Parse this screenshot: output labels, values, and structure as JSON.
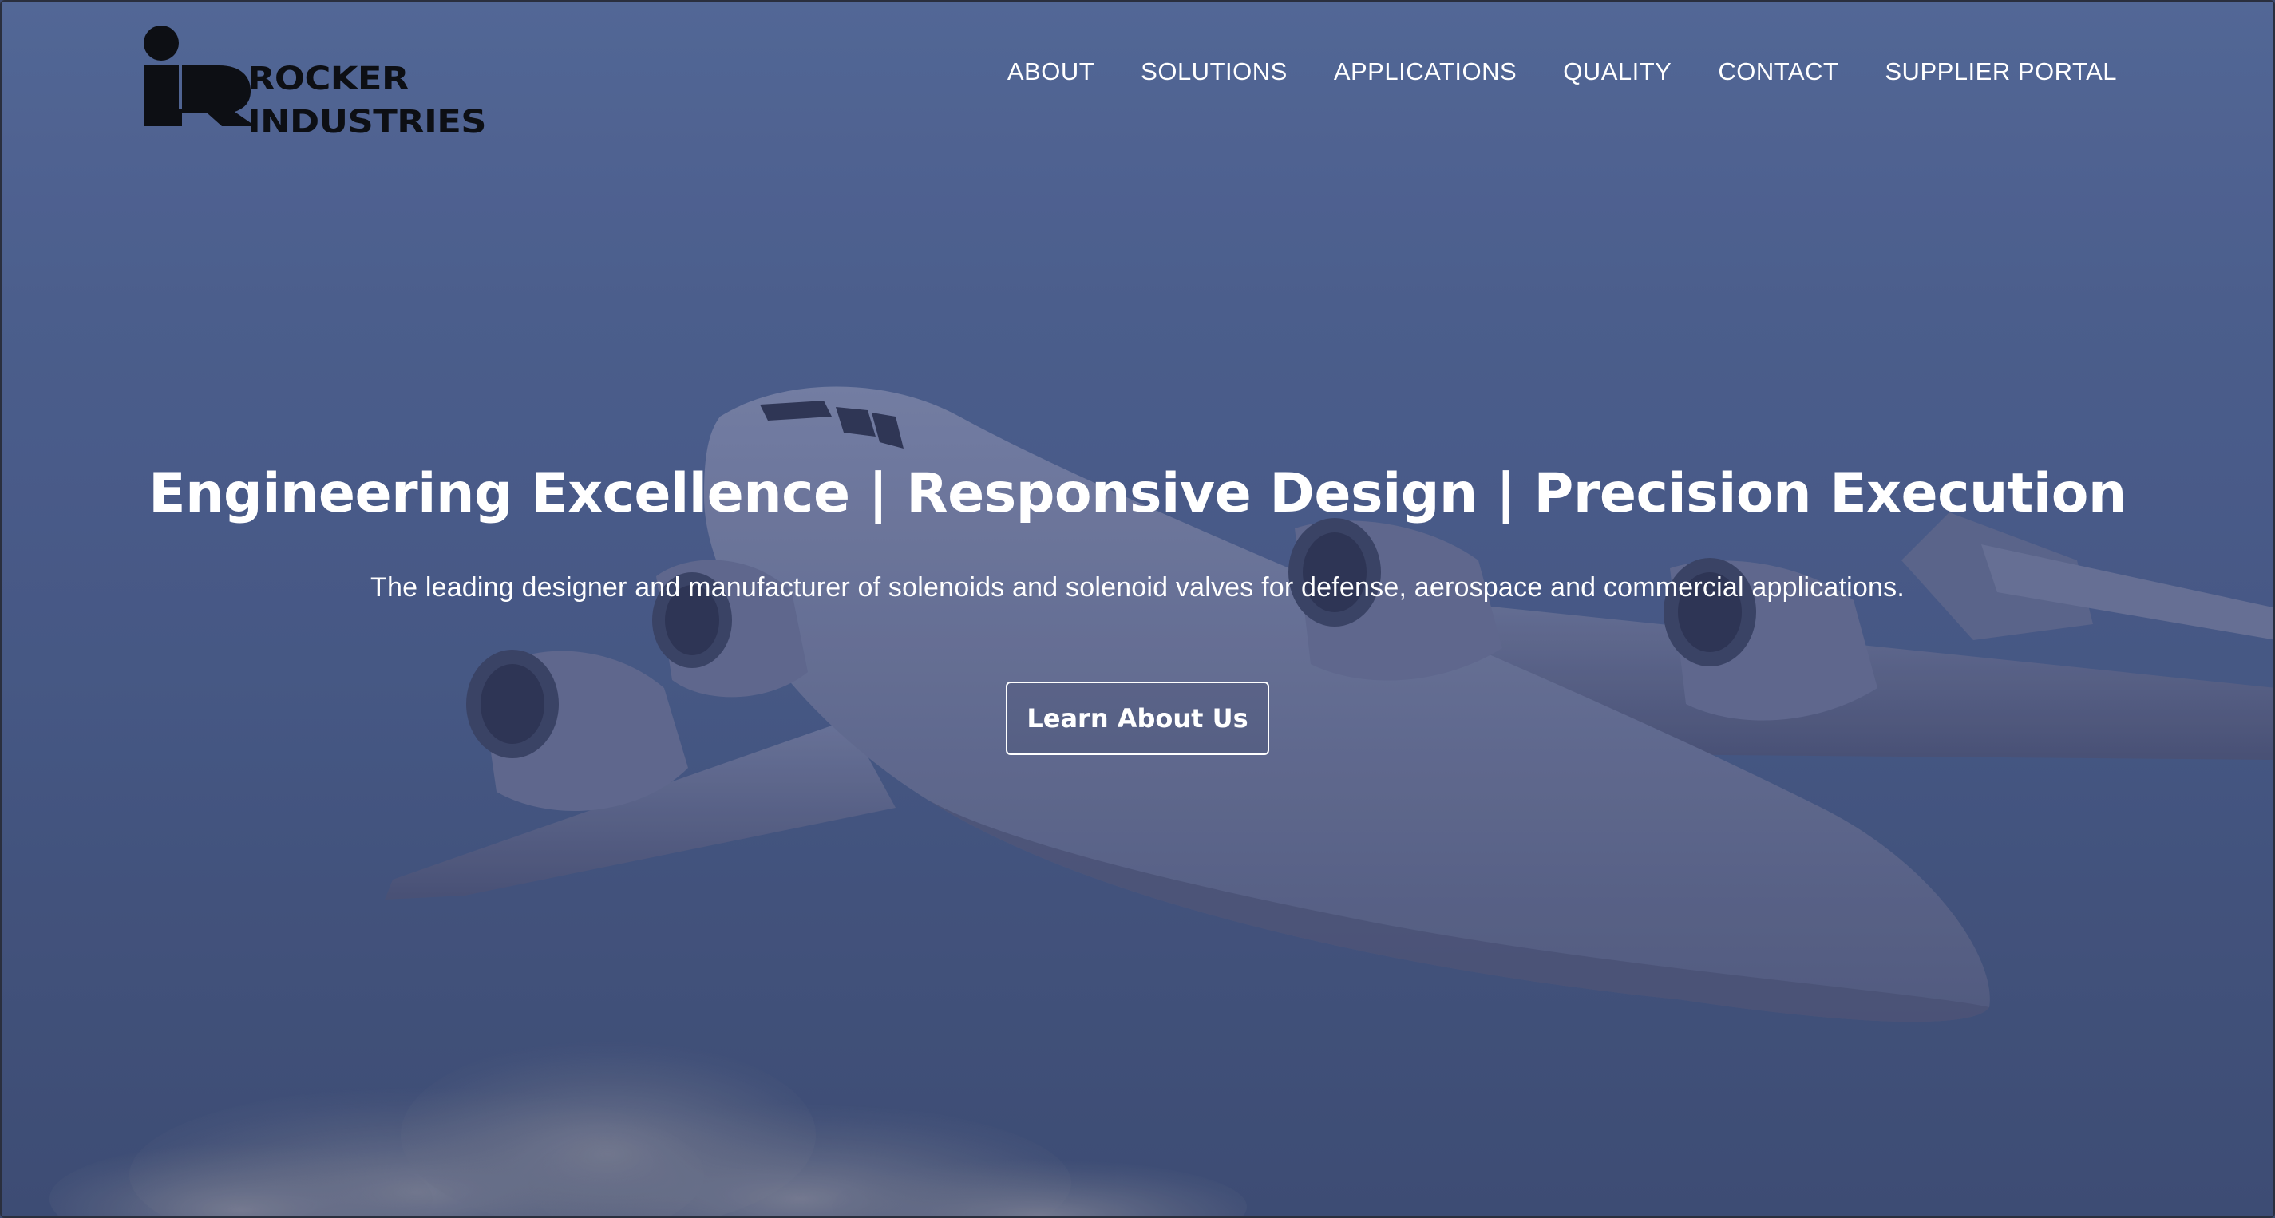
{
  "brand": {
    "logo_mark": "iR",
    "name_line1": "ROCKER",
    "name_line2": "INDUSTRIES"
  },
  "nav": {
    "items": [
      {
        "label": "ABOUT"
      },
      {
        "label": "SOLUTIONS"
      },
      {
        "label": "APPLICATIONS"
      },
      {
        "label": "QUALITY"
      },
      {
        "label": "CONTACT"
      },
      {
        "label": "SUPPLIER PORTAL"
      }
    ]
  },
  "hero": {
    "title": "Engineering Excellence | Responsive Design | Precision Execution",
    "subtitle": "The leading designer and manufacturer of solenoids and solenoid valves for defense, aerospace and commercial applications.",
    "cta_label": "Learn About Us",
    "background": "military-cargo-aircraft-photo"
  },
  "colors": {
    "sky_top": "#556b9a",
    "sky_bottom": "#3d4d74",
    "text": "#ffffff",
    "logo": "#0d0f14"
  }
}
